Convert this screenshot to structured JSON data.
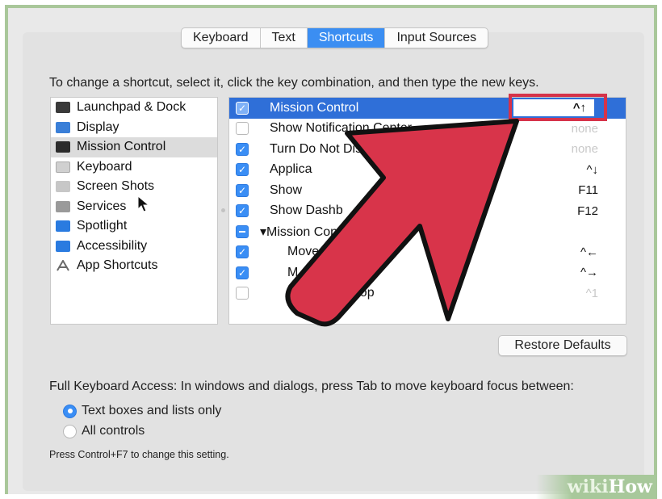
{
  "tabs": [
    {
      "label": "Keyboard",
      "active": false
    },
    {
      "label": "Text",
      "active": false
    },
    {
      "label": "Shortcuts",
      "active": true
    },
    {
      "label": "Input Sources",
      "active": false
    }
  ],
  "instruction": "To change a shortcut, select it, click the key combination, and then type the new keys.",
  "categories": [
    {
      "label": "Launchpad & Dock",
      "icon": "launchpad-icon",
      "selected": false
    },
    {
      "label": "Display",
      "icon": "display-icon",
      "selected": false
    },
    {
      "label": "Mission Control",
      "icon": "mission-control-icon",
      "selected": true
    },
    {
      "label": "Keyboard",
      "icon": "keyboard-icon",
      "selected": false
    },
    {
      "label": "Screen Shots",
      "icon": "screenshot-icon",
      "selected": false
    },
    {
      "label": "Services",
      "icon": "gear-icon",
      "selected": false
    },
    {
      "label": "Spotlight",
      "icon": "spotlight-icon",
      "selected": false
    },
    {
      "label": "Accessibility",
      "icon": "accessibility-icon",
      "selected": false
    },
    {
      "label": "App Shortcuts",
      "icon": "app-shortcuts-icon",
      "selected": false
    }
  ],
  "shortcuts": [
    {
      "label": "Mission Control",
      "key": "^↑",
      "state": "on",
      "selected": true
    },
    {
      "label": "Show Notification Center",
      "key": "none",
      "state": "off"
    },
    {
      "label": "Turn Do Not Disturb O",
      "key": "none",
      "state": "on"
    },
    {
      "label": "Applica",
      "key": "^↓",
      "state": "on"
    },
    {
      "label": "Show",
      "key": "F11",
      "state": "on"
    },
    {
      "label": "Show Dashb",
      "key": "F12",
      "state": "on"
    },
    {
      "label": "▾Mission Cont",
      "key": "",
      "state": "mixed",
      "group": true
    },
    {
      "label": "Move",
      "key": "^←",
      "state": "on",
      "indent": true
    },
    {
      "label": "M        pace",
      "key": "^→",
      "state": "on",
      "indent": true
    },
    {
      "label": "           Desktop",
      "key": "^1",
      "state": "off",
      "indent": true
    }
  ],
  "restore_button": "Restore Defaults",
  "full_keyboard_access": "Full Keyboard Access: In windows and dialogs, press Tab to move keyboard focus between:",
  "radio_options": [
    {
      "label": "Text boxes and lists only",
      "selected": true
    },
    {
      "label": "All controls",
      "selected": false
    }
  ],
  "note": "Press Control+F7 to change this setting.",
  "watermark": {
    "wiki": "wiki",
    "how": "How"
  },
  "colors": {
    "accent": "#3b8ef2",
    "selection": "#2f6fd8",
    "annotation": "#d6334a"
  }
}
